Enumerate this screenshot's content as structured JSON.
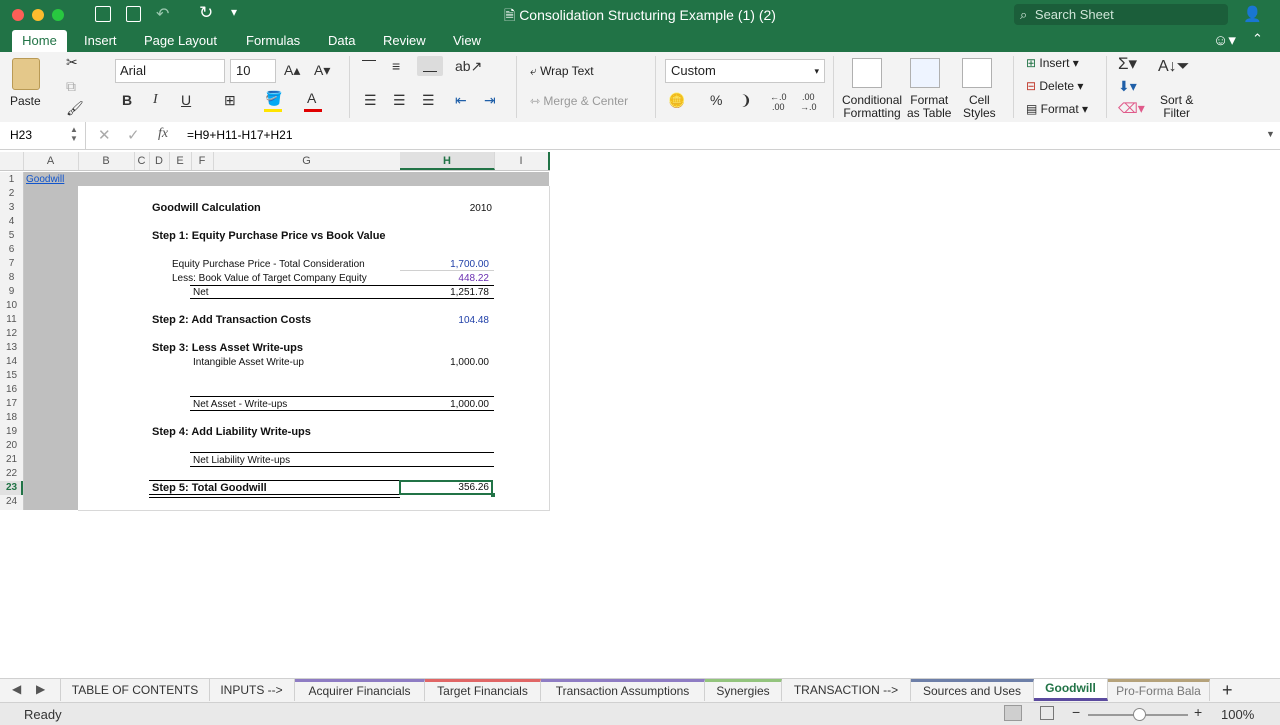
{
  "window": {
    "title": "Consolidation Structuring Example (1) (2)",
    "search_placeholder": "Search Sheet"
  },
  "ribbon_tabs": [
    "Home",
    "Insert",
    "Page Layout",
    "Formulas",
    "Data",
    "Review",
    "View"
  ],
  "ribbon": {
    "paste": "Paste",
    "font": "Arial",
    "size": "10",
    "wrap": "Wrap Text",
    "merge": "Merge & Center",
    "number_format": "Custom",
    "cond1": "Conditional",
    "cond2": "Formatting",
    "fmt1": "Format",
    "fmt2": "as Table",
    "cell1": "Cell",
    "cell2": "Styles",
    "insert": "Insert",
    "delete": "Delete",
    "format": "Format",
    "sort1": "Sort &",
    "sort2": "Filter"
  },
  "formula_bar": {
    "cell_ref": "H23",
    "formula": "=H9+H11-H17+H21"
  },
  "columns": [
    "A",
    "B",
    "C",
    "D",
    "E",
    "F",
    "G",
    "H",
    "I"
  ],
  "rows": [
    "1",
    "2",
    "3",
    "4",
    "5",
    "6",
    "7",
    "8",
    "9",
    "10",
    "11",
    "12",
    "13",
    "14",
    "15",
    "16",
    "17",
    "18",
    "19",
    "20",
    "21",
    "22",
    "23",
    "24"
  ],
  "sheet": {
    "link": "Goodwill",
    "title": "Goodwill Calculation",
    "year": "2010",
    "step1": "Step 1: Equity Purchase Price vs Book Value",
    "r7_label": "Equity Purchase Price - Total Consideration",
    "r7_val": "1,700.00",
    "r8_label": "Less: Book Value of Target Company Equity",
    "r8_val": "448.22",
    "r9_label": "Net",
    "r9_val": "1,251.78",
    "step2": "Step 2: Add Transaction Costs",
    "step2_val": "104.48",
    "step3": "Step 3: Less Asset Write-ups",
    "r14_label": "Intangible Asset Write-up",
    "r14_val": "1,000.00",
    "r17_label": "Net Asset - Write-ups",
    "r17_val": "1,000.00",
    "step4": "Step 4: Add Liability Write-ups",
    "r21_label": "Net Liability Write-ups",
    "step5": "Step 5: Total Goodwill",
    "step5_val": "356.26"
  },
  "sheet_tabs": [
    "TABLE OF CONTENTS",
    "INPUTS -->",
    "Acquirer Financials",
    "Target Financials",
    "Transaction Assumptions",
    "Synergies",
    "TRANSACTION -->",
    "Sources and Uses",
    "Goodwill",
    "Pro-Forma Bala"
  ],
  "status": {
    "ready": "Ready",
    "zoom": "100%"
  }
}
